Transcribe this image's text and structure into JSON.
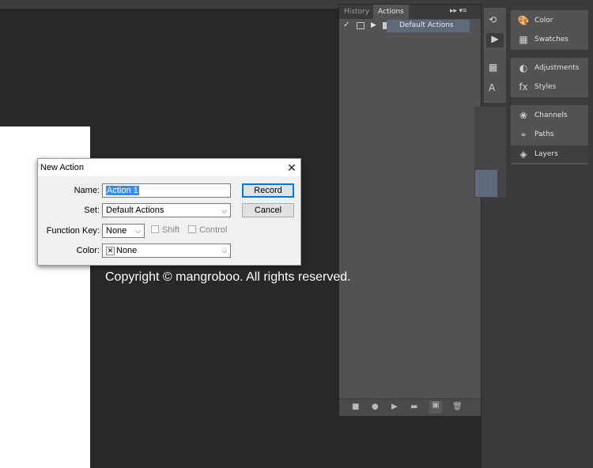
{
  "actions_panel": {
    "tabs": [
      "History",
      "Actions"
    ],
    "menu_glyphs": "▸▸  ▾≡",
    "row_label": "Default Actions"
  },
  "right_panels": {
    "items": [
      "Color",
      "Swatches",
      "Adjustments",
      "Styles",
      "Channels",
      "Paths",
      "Layers"
    ]
  },
  "dialog": {
    "title": "New Action",
    "name_label": "Name:",
    "name_value": "Action 1",
    "set_label": "Set:",
    "set_value": "Default Actions",
    "function_key_label": "Function Key:",
    "function_key_value": "None",
    "shift_label": "Shift",
    "control_label": "Control",
    "color_label": "Color:",
    "color_value": "None",
    "record_label": "Record",
    "cancel_label": "Cancel"
  },
  "watermark": "Copyright © mangroboo. All rights reserved."
}
